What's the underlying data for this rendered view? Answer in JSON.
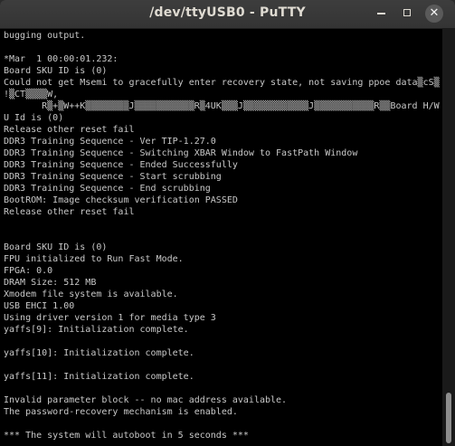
{
  "window": {
    "title": "/dev/ttyUSB0 - PuTTY",
    "controls": {
      "minimize_icon": "minimize-icon",
      "maximize_icon": "maximize-icon",
      "close_icon": "close-icon",
      "close_glyph": "✕"
    }
  },
  "terminal": {
    "lines": [
      "bugging output.",
      "",
      "*Mar  1 00:00:01.232:",
      "Board SKU ID is (0)",
      "Could not get Msemi to gracefully enter recovery state, not saving ppoe data▒cS▒",
      "!▒CT▒▒▒▒W,",
      "       R▒+▒W++K▒▒▒▒▒▒▒▒J▒▒▒▒▒▒▒▒▒▒▒R▒4UK▒▒▒J▒▒▒▒▒▒▒▒▒▒▒▒J▒▒▒▒▒▒▒▒▒▒▒R▒▒Board H/W SK",
      "U Id is (0)",
      "Release other reset fail",
      "DDR3 Training Sequence - Ver TIP-1.27.0",
      "DDR3 Training Sequence - Switching XBAR Window to FastPath Window",
      "DDR3 Training Sequence - Ended Successfully",
      "DDR3 Training Sequence - Start scrubbing",
      "DDR3 Training Sequence - End scrubbing",
      "BootROM: Image checksum verification PASSED",
      "Release other reset fail",
      "",
      "",
      "Board SKU ID is (0)",
      "FPU initialized to Run Fast Mode.",
      "FPGA: 0.0",
      "DRAM Size: 512 MB",
      "Xmodem file system is available.",
      "USB EHCI 1.00",
      "Using driver version 1 for media type 3",
      "yaffs[9]: Initialization complete.",
      "",
      "yaffs[10]: Initialization complete.",
      "",
      "yaffs[11]: Initialization complete.",
      "",
      "Invalid parameter block -- no mac address available.",
      "The password-recovery mechanism is enabled.",
      "",
      "*** The system will autoboot in 5 seconds ***"
    ]
  },
  "scrollbar": {
    "position_fraction": 0.93
  },
  "colors": {
    "terminal_bg": "#000000",
    "terminal_fg": "#c9c9c9",
    "titlebar_bg": "#3a3a3a",
    "title_fg": "#dfdbd2"
  }
}
